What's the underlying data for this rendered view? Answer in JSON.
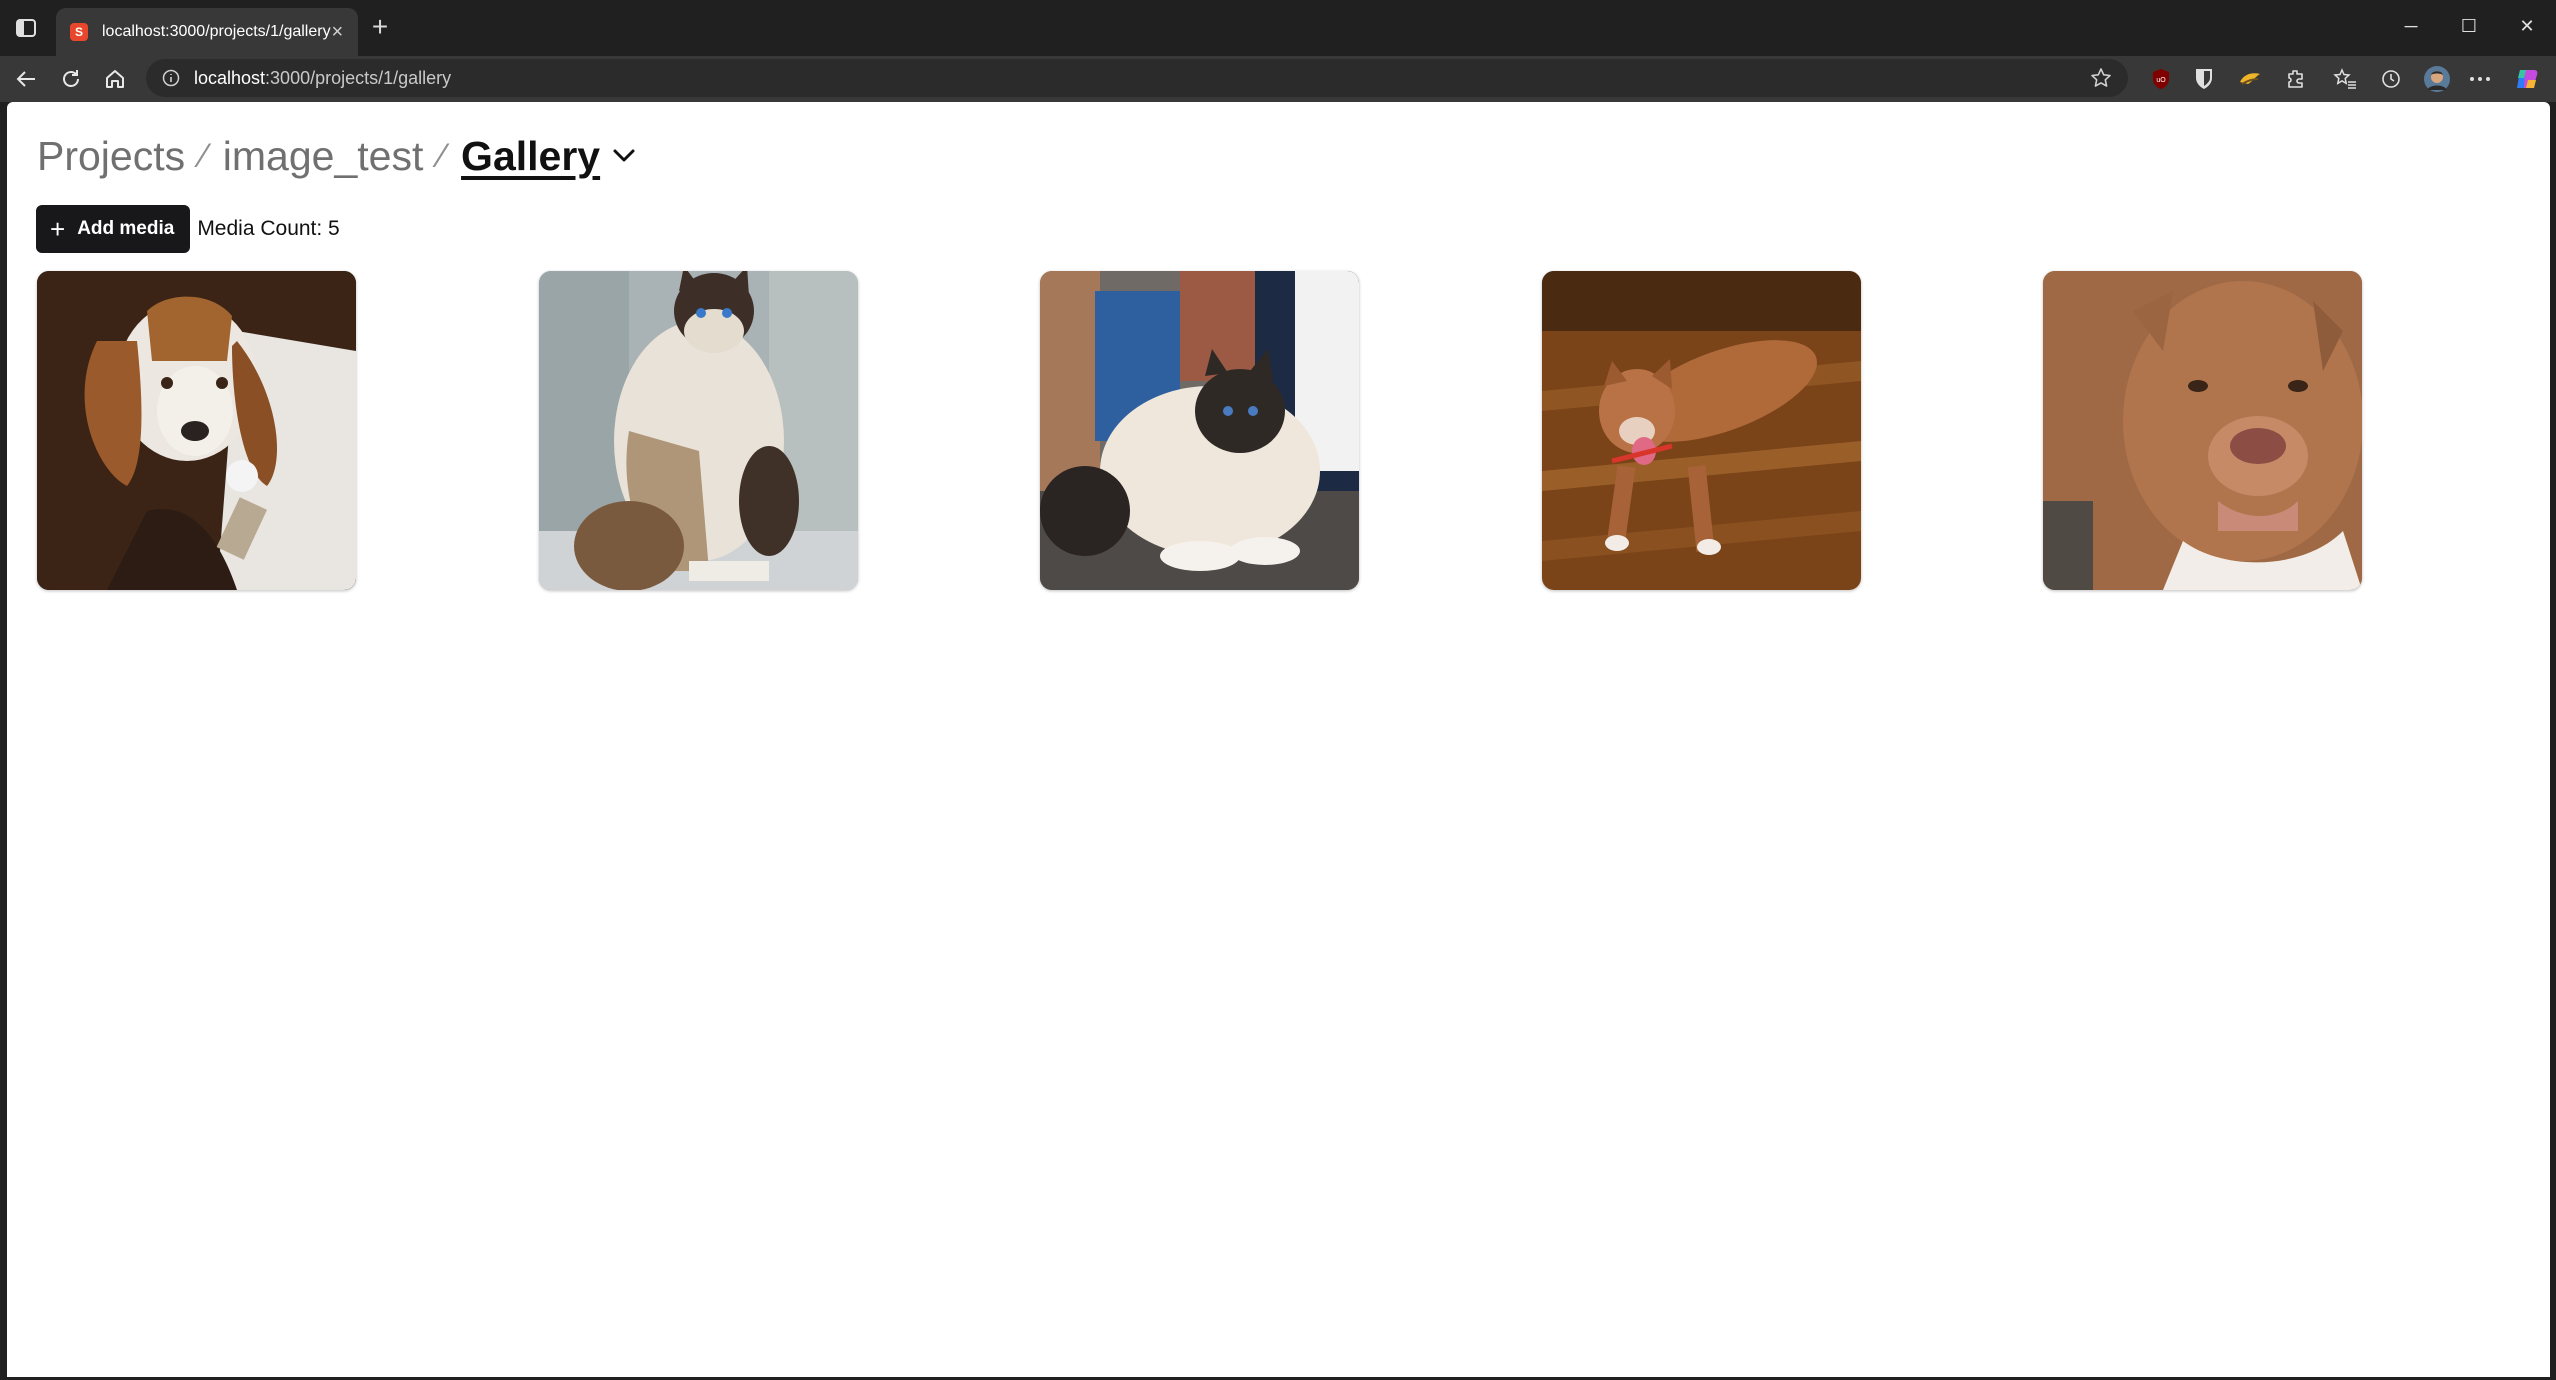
{
  "browser": {
    "tab_title": "localhost:3000/projects/1/gallery",
    "tab_favicon": "S",
    "url_host": "localhost",
    "url_rest": ":3000/projects/1/gallery",
    "new_tab": "+",
    "tab_close": "×",
    "window_controls": {
      "minimize": "─",
      "maximize": "☐",
      "close": "✕"
    },
    "extension_icons": [
      "ublock-icon",
      "bitwarden-icon",
      "sticky-extension-icon",
      "extensions-icon",
      "favorites-icon",
      "history-icon",
      "profile-avatar",
      "more-icon",
      "copilot-icon"
    ]
  },
  "breadcrumb": {
    "items": [
      "Projects",
      "image_test"
    ],
    "separator": "⁄",
    "current": "Gallery"
  },
  "actions": {
    "add_media_label": "Add media",
    "add_media_icon": "+",
    "media_count": "Media Count: 5"
  },
  "gallery": {
    "items": [
      {
        "subject": "basset-hound-photo"
      },
      {
        "subject": "ragdoll-cat-photo"
      },
      {
        "subject": "birman-cat-photo"
      },
      {
        "subject": "pitbull-on-floor-photo"
      },
      {
        "subject": "pitbull-portrait-photo"
      }
    ]
  }
}
